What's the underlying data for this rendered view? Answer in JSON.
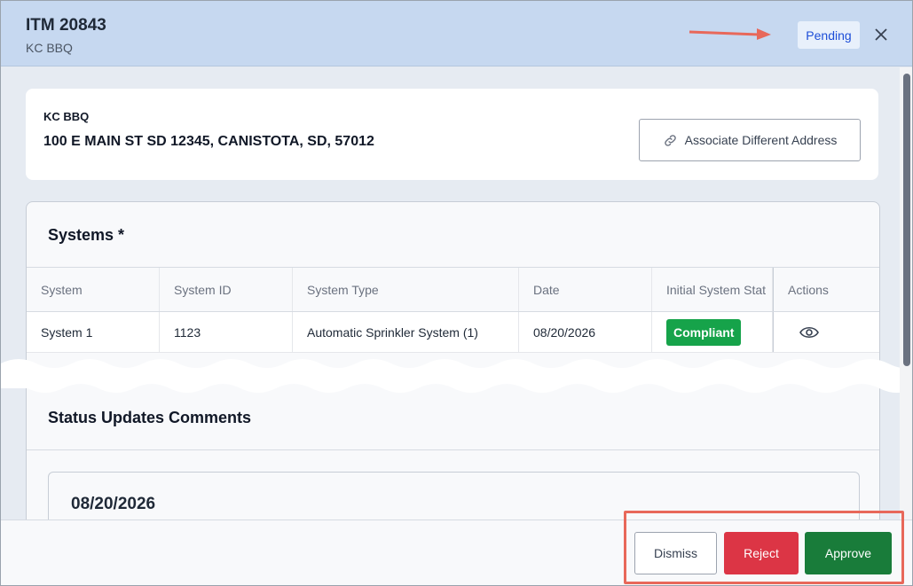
{
  "header": {
    "title": "ITM 20843",
    "subtitle": "KC BBQ",
    "status_badge": "Pending"
  },
  "address": {
    "name": "KC BBQ",
    "line": "100 E MAIN ST SD 12345, CANISTOTA, SD, 57012",
    "associate_button": "Associate Different Address"
  },
  "systems": {
    "title": "Systems *",
    "columns": [
      "System",
      "System ID",
      "System Type",
      "Date",
      "Initial System Stat",
      "Actions"
    ],
    "rows": [
      {
        "system": "System 1",
        "system_id": "1123",
        "system_type": "Automatic Sprinkler System (1)",
        "date": "08/20/2026",
        "status": "Compliant",
        "action_icon": "eye-icon"
      }
    ]
  },
  "status_updates": {
    "title": "Status Updates Comments",
    "date": "08/20/2026"
  },
  "footer": {
    "dismiss": "Dismiss",
    "reject": "Reject",
    "approve": "Approve"
  },
  "colors": {
    "header_bg": "#c6d8f0",
    "compliant": "#16a34a",
    "reject": "#dc3545",
    "approve": "#197c3a",
    "annotation": "#e8685a"
  }
}
